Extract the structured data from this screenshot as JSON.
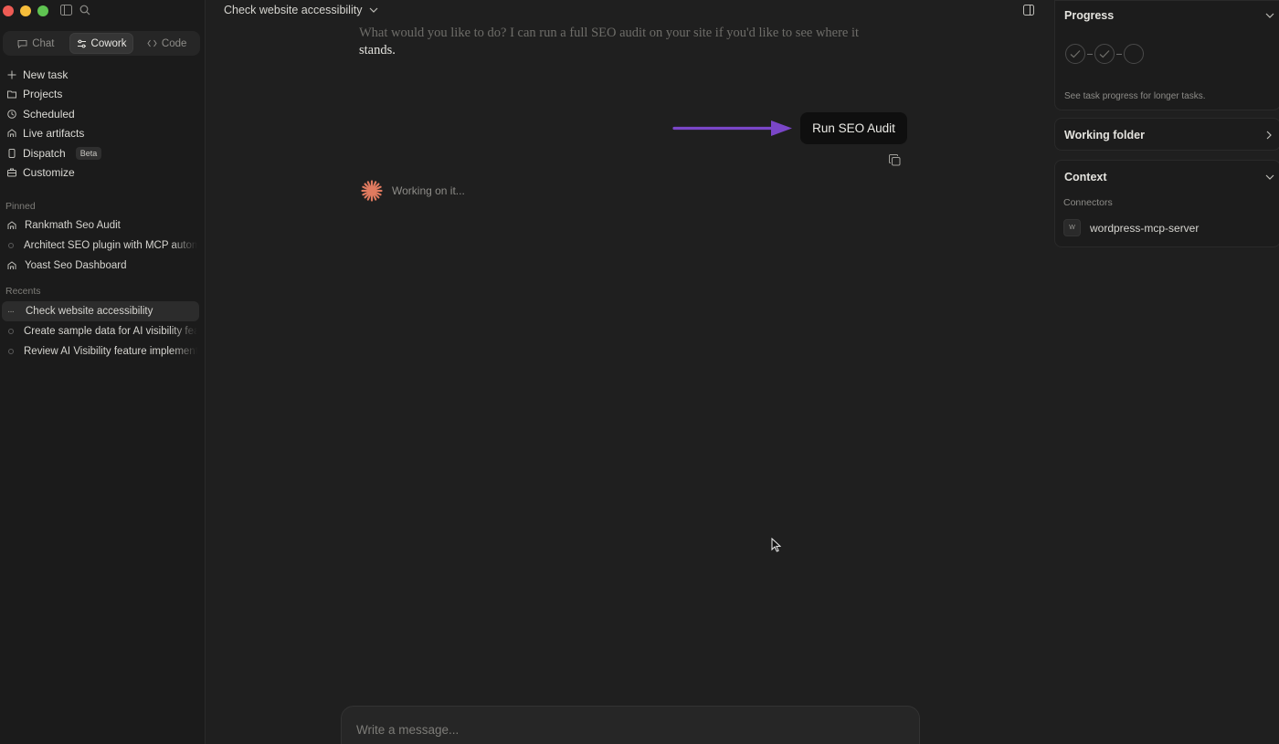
{
  "colors": {
    "accent_arrow": "#7a46c8",
    "spark": "#e07a5f",
    "background": "#1f1f1f",
    "sidebar": "#1b1b1b"
  },
  "modes": [
    {
      "label": "Chat",
      "icon": "chat-bubble-icon",
      "active": false
    },
    {
      "label": "Cowork",
      "icon": "sliders-icon",
      "active": true
    },
    {
      "label": "Code",
      "icon": "code-brackets-icon",
      "active": false
    }
  ],
  "nav": {
    "new_task": "New task",
    "projects": "Projects",
    "scheduled": "Scheduled",
    "live_artifacts": "Live artifacts",
    "dispatch": "Dispatch",
    "dispatch_badge": "Beta",
    "customize": "Customize"
  },
  "pinned": {
    "label": "Pinned",
    "items": [
      "Rankmath Seo Audit",
      "Architect SEO plugin with MCP automation",
      "Yoast Seo Dashboard"
    ]
  },
  "recents": {
    "label": "Recents",
    "items": [
      "Check website accessibility",
      "Create sample data for AI visibility feature",
      "Review AI Visibility feature implementation"
    ]
  },
  "header": {
    "title": "Check website accessibility"
  },
  "conversation": {
    "assistant_text_faded": "What would you like to do? I can run a full SEO audit on your site if you'd like to see where it",
    "assistant_text": "stands.",
    "user_message": "Run SEO Audit",
    "status": "Working on it..."
  },
  "composer": {
    "placeholder": "Write a message..."
  },
  "right_panel": {
    "progress_title": "Progress",
    "progress_steps": [
      "done",
      "done",
      "pending"
    ],
    "progress_hint": "See task progress for longer tasks.",
    "working_folder_title": "Working folder",
    "context_title": "Context",
    "connectors_label": "Connectors",
    "connector_icon_letter": "W",
    "connector_name": "wordpress-mcp-server"
  }
}
